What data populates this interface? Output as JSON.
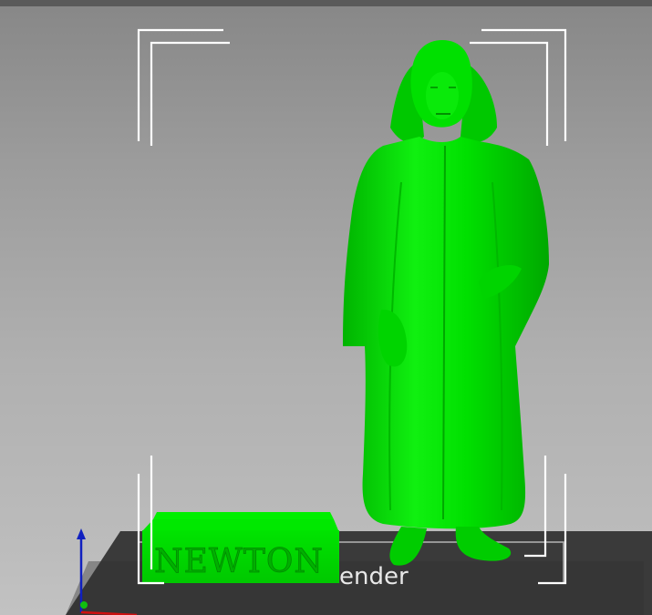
{
  "viewport": {
    "background_top": "#878787",
    "background_bottom": "#c2c2c2"
  },
  "bed": {
    "color": "#3a3a3a",
    "logo_text": "ender",
    "logo_color": "#e8e8e8"
  },
  "objects": [
    {
      "name": "newton-statue",
      "color": "#00e000"
    },
    {
      "name": "newton-base",
      "color": "#00d800",
      "engraved_text": "NEWTON"
    }
  ],
  "axes": {
    "x_color": "#d01010",
    "y_color": "#10c010",
    "z_color": "#1020c0"
  },
  "selection_box": {
    "color": "#ffffff"
  }
}
